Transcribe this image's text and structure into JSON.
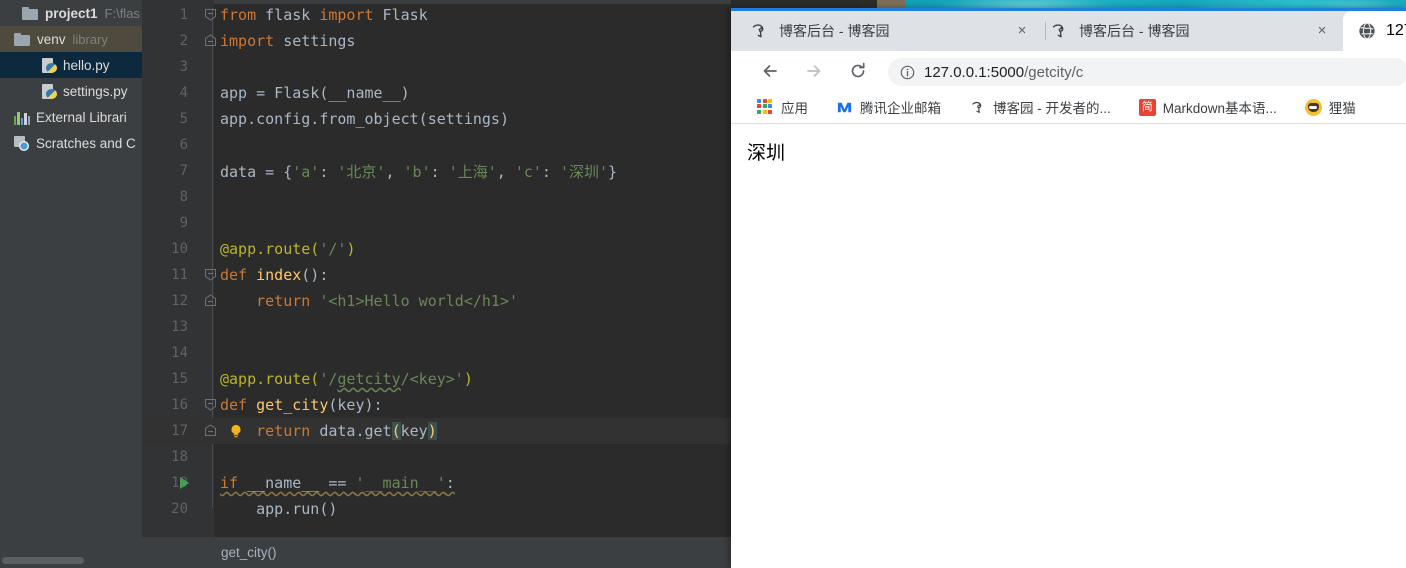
{
  "ide": {
    "project_tree": [
      {
        "label": "project1",
        "sub": "F:\\flas",
        "icon": "folder-icon",
        "bold": true,
        "state": "normal",
        "indent": 0
      },
      {
        "label": "venv",
        "sub": "library",
        "icon": "folder-icon",
        "bold": false,
        "state": "highlighted",
        "indent": 1,
        "arrow": "collapsed"
      },
      {
        "label": "hello.py",
        "sub": "",
        "icon": "python-file-icon",
        "bold": false,
        "state": "selected",
        "indent": 2
      },
      {
        "label": "settings.py",
        "sub": "",
        "icon": "python-file-icon",
        "bold": false,
        "state": "normal",
        "indent": 2
      },
      {
        "label": "External Librari",
        "sub": "",
        "icon": "external-libraries-icon",
        "bold": false,
        "state": "normal",
        "indent": 1
      },
      {
        "label": "Scratches and C",
        "sub": "",
        "icon": "scratches-icon",
        "bold": false,
        "state": "normal",
        "indent": 1
      }
    ],
    "breadcrumb": "get_city()",
    "code_lines": [
      {
        "n": "1",
        "fold": "fold-minus-top",
        "tokens": [
          {
            "t": "from",
            "c": "k"
          },
          {
            "t": " flask ",
            "c": "p"
          },
          {
            "t": "import",
            "c": "k"
          },
          {
            "t": " Flask",
            "c": "p"
          }
        ]
      },
      {
        "n": "2",
        "fold": "fold-minus-bottom",
        "tokens": [
          {
            "t": "import",
            "c": "k"
          },
          {
            "t": " settings",
            "c": "p"
          }
        ]
      },
      {
        "n": "3",
        "tokens": []
      },
      {
        "n": "4",
        "tokens": [
          {
            "t": "app = Flask(__name__)",
            "c": "p"
          }
        ]
      },
      {
        "n": "5",
        "tokens": [
          {
            "t": "app.config.from_object(settings)",
            "c": "p"
          }
        ]
      },
      {
        "n": "6",
        "tokens": []
      },
      {
        "n": "7",
        "tokens": [
          {
            "t": "data = {",
            "c": "p"
          },
          {
            "t": "'a'",
            "c": "s"
          },
          {
            "t": ": ",
            "c": "p"
          },
          {
            "t": "'北京'",
            "c": "s"
          },
          {
            "t": ", ",
            "c": "p"
          },
          {
            "t": "'b'",
            "c": "s"
          },
          {
            "t": ": ",
            "c": "p"
          },
          {
            "t": "'上海'",
            "c": "s"
          },
          {
            "t": ", ",
            "c": "p"
          },
          {
            "t": "'c'",
            "c": "s"
          },
          {
            "t": ": ",
            "c": "p"
          },
          {
            "t": "'深圳'",
            "c": "s"
          },
          {
            "t": "}",
            "c": "p"
          }
        ]
      },
      {
        "n": "8",
        "tokens": []
      },
      {
        "n": "9",
        "tokens": []
      },
      {
        "n": "10",
        "tokens": [
          {
            "t": "@app.route(",
            "c": "d"
          },
          {
            "t": "'/'",
            "c": "s"
          },
          {
            "t": ")",
            "c": "d"
          }
        ]
      },
      {
        "n": "11",
        "fold": "fold-minus-top",
        "tokens": [
          {
            "t": "def",
            "c": "k"
          },
          {
            "t": " ",
            "c": "p"
          },
          {
            "t": "index",
            "c": "fn"
          },
          {
            "t": "():",
            "c": "p"
          }
        ]
      },
      {
        "n": "12",
        "fold": "fold-minus-bottom",
        "tokens": [
          {
            "t": "    ",
            "c": "p"
          },
          {
            "t": "return",
            "c": "k"
          },
          {
            "t": " ",
            "c": "p"
          },
          {
            "t": "'<h1>Hello world</h1>'",
            "c": "s"
          }
        ]
      },
      {
        "n": "13",
        "tokens": []
      },
      {
        "n": "14",
        "tokens": []
      },
      {
        "n": "15",
        "tokens": [
          {
            "t": "@app.route(",
            "c": "d"
          },
          {
            "t": "'/",
            "c": "s"
          },
          {
            "t": "getcity",
            "c": "s wavy"
          },
          {
            "t": "/<key>'",
            "c": "s"
          },
          {
            "t": ")",
            "c": "d"
          }
        ]
      },
      {
        "n": "16",
        "fold": "fold-minus-top",
        "tokens": [
          {
            "t": "def",
            "c": "k"
          },
          {
            "t": " ",
            "c": "p"
          },
          {
            "t": "get_city",
            "c": "fn"
          },
          {
            "t": "(key):",
            "c": "p"
          }
        ]
      },
      {
        "n": "17",
        "fold": "fold-minus-bottom",
        "bulb": true,
        "current": true,
        "tokens": [
          {
            "t": "    ",
            "c": "p"
          },
          {
            "t": "return",
            "c": "k"
          },
          {
            "t": " data.get",
            "c": "p"
          },
          {
            "t": "(",
            "c": "hlp"
          },
          {
            "t": "key",
            "c": "p"
          },
          {
            "t": ")",
            "c": "hlp"
          }
        ]
      },
      {
        "n": "18",
        "tokens": []
      },
      {
        "n": "19",
        "run": true,
        "tokens": [
          {
            "t": "if",
            "c": "k wavy2"
          },
          {
            "t": " __name__ == ",
            "c": "p wavy2"
          },
          {
            "t": "'__main__'",
            "c": "s wavy2"
          },
          {
            "t": ":",
            "c": "p wavy2"
          }
        ]
      },
      {
        "n": "20",
        "tokens": [
          {
            "t": "    app.run()",
            "c": "p"
          }
        ]
      }
    ]
  },
  "browser": {
    "tabs": [
      {
        "title": "博客后台 - 博客园",
        "favicon": "cnblogs-icon",
        "active": false,
        "close": "×"
      },
      {
        "title": "博客后台 - 博客园",
        "favicon": "cnblogs-icon",
        "active": false,
        "close": "×"
      },
      {
        "title": "127",
        "favicon": "globe-icon",
        "active": true
      }
    ],
    "toolbar": {
      "back_icon": "arrow-back-icon",
      "forward_icon": "arrow-forward-icon",
      "reload_icon": "reload-icon",
      "info_icon": "page-info-icon",
      "url_host": "127.0.0.1:5000",
      "url_path": "/getcity/c",
      "url_full": "127.0.0.1:5000/getcity/c"
    },
    "bookmarks": [
      {
        "label": "应用",
        "icon": "apps-grid-icon"
      },
      {
        "label": "腾讯企业邮箱",
        "icon": "tencent-mail-icon"
      },
      {
        "label": "博客园 - 开发者的...",
        "icon": "cnblogs-icon"
      },
      {
        "label": "Markdown基本语...",
        "icon": "jianshu-icon",
        "icon_text": "简"
      },
      {
        "label": "狸猫",
        "icon": "cat-avatar-icon"
      }
    ],
    "page_content": "深圳"
  },
  "colors": {
    "ide_chrome": "#3c3f41",
    "editor_bg": "#2b2b2b",
    "gutter_bg": "#313335",
    "selected_row": "#0d293e",
    "highlight_row": "#4e4a3d",
    "keyword": "#cc7832",
    "string": "#6a8759",
    "decorator": "#bbb529",
    "function": "#ffc66d",
    "plain": "#a9b7c6",
    "browser_chrome": "#dee1e6",
    "browser_topline": "#1f7fe0",
    "wallpaper": "#18a9bd",
    "run_green": "#499c54"
  }
}
